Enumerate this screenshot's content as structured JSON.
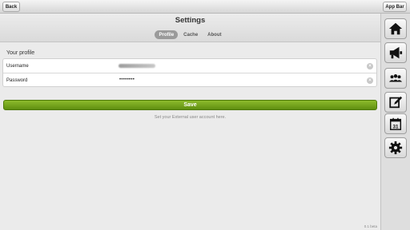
{
  "topbar": {
    "back_label": "Back",
    "appbar_label": "App Bar"
  },
  "header": {
    "title": "Settings",
    "tabs": [
      {
        "label": "Profile",
        "active": true
      },
      {
        "label": "Cache",
        "active": false
      },
      {
        "label": "About",
        "active": false
      }
    ]
  },
  "profile": {
    "section_title": "Your profile",
    "username_label": "Username",
    "password_label": "Password",
    "password_value": "••••••••",
    "save_label": "Save",
    "hint": "Set your External user account here."
  },
  "footer": {
    "version": "0.1 beta"
  },
  "sidebar": {
    "items": [
      "home-icon",
      "megaphone-icon",
      "people-icon",
      "edit-icon",
      "calendar-icon",
      "gear-icon"
    ],
    "calendar_day": "31"
  }
}
